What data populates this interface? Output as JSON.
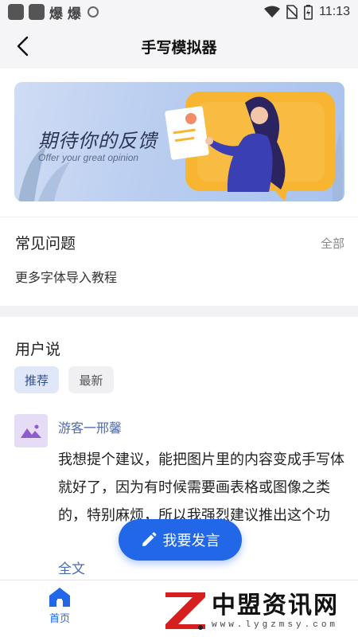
{
  "status_bar": {
    "time": "11:13",
    "notification_text": "爆 爆"
  },
  "app_bar": {
    "title": "手写模拟器"
  },
  "banner": {
    "title": "期待你的反馈",
    "subtitle": "Offer your great opinion"
  },
  "faq": {
    "title": "常见问题",
    "all_label": "全部",
    "items": [
      "更多字体导入教程"
    ]
  },
  "user_feedback": {
    "title": "用户说",
    "tabs": [
      {
        "label": "推荐",
        "active": true
      },
      {
        "label": "最新",
        "active": false
      }
    ],
    "posts": [
      {
        "username": "游客一邢馨",
        "text": "我想提个建议，能把图片里的内容变成手写体就好了，因为有时候需要画表格或图像之类的，特别麻烦，所以我强烈建议推出这个功",
        "more_label": "全文"
      }
    ]
  },
  "fab": {
    "label": "我要发言"
  },
  "bottom_nav": {
    "items": [
      {
        "label": "首页",
        "icon": "home-icon",
        "active": true
      }
    ]
  },
  "watermark": {
    "name": "中盟资讯网",
    "url": "www.lygzmsy.com"
  },
  "colors": {
    "accent": "#2267e8",
    "link": "#4b6bb0",
    "tab_active_bg": "#dfe7f8",
    "banner_yellow": "#f7b532",
    "banner_blue": "#b9cdf0"
  }
}
